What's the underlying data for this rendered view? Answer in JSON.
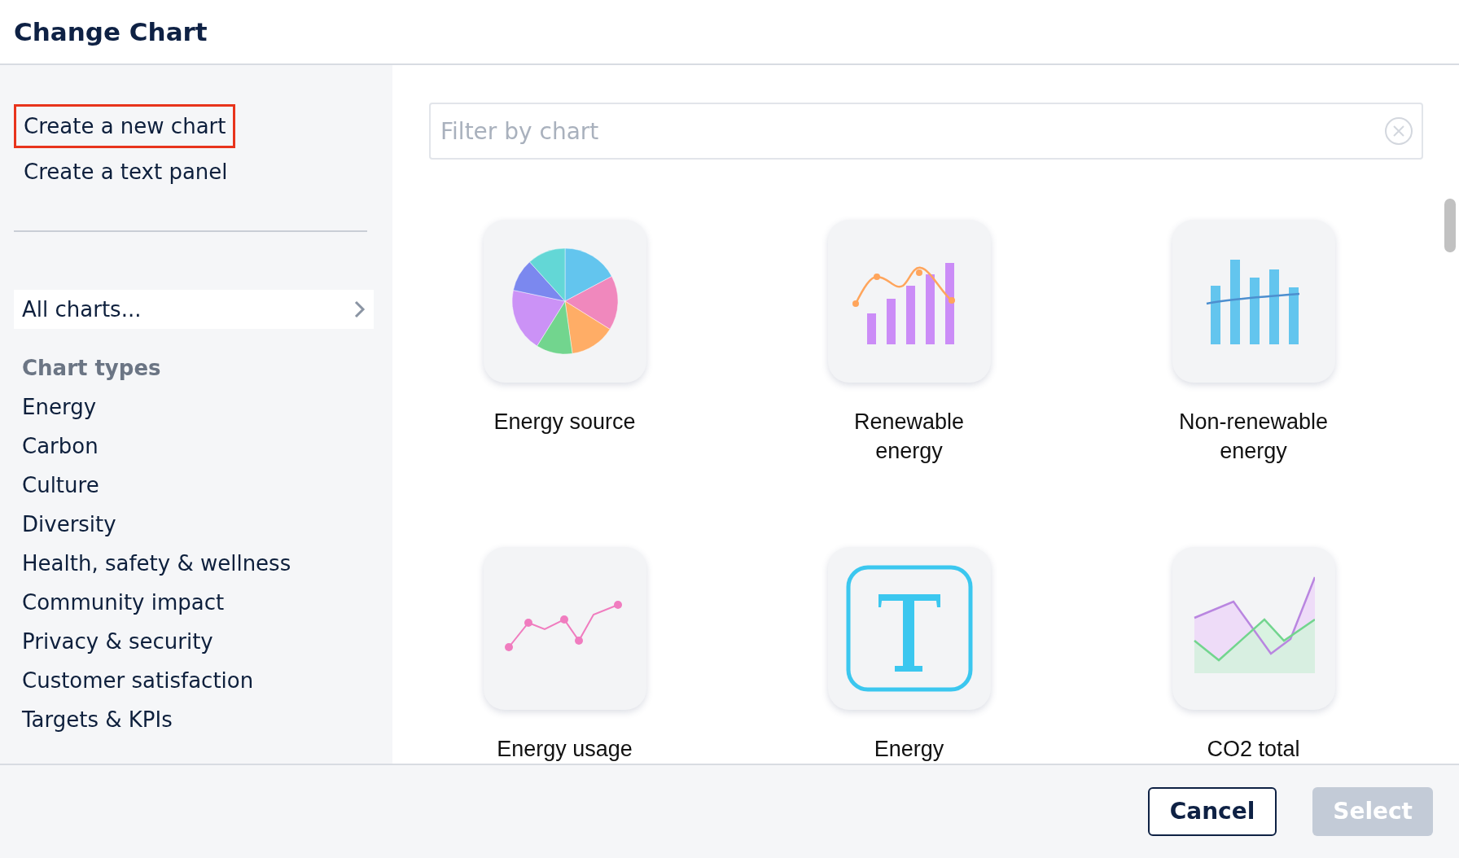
{
  "window": {
    "title": "Change Chart"
  },
  "sidebar": {
    "actions": [
      {
        "label": "Create a new chart",
        "selected": true
      },
      {
        "label": "Create a text panel",
        "selected": false
      }
    ],
    "all_charts": "All charts...",
    "section_title": "Chart types",
    "items": [
      "Energy",
      "Carbon",
      "Culture",
      "Diversity",
      "Health, safety & wellness",
      "Community impact",
      "Privacy & security",
      "Customer satisfaction",
      "Targets & KPIs"
    ]
  },
  "search": {
    "placeholder": "Filter by chart"
  },
  "charts": [
    {
      "kind": "pie",
      "label": "Energy source"
    },
    {
      "kind": "combo",
      "label": "Renewable energy"
    },
    {
      "kind": "bar",
      "label": "Non-renewable energy"
    },
    {
      "kind": "line",
      "label": "Energy usage"
    },
    {
      "kind": "text",
      "label": "Energy"
    },
    {
      "kind": "area",
      "label": "CO2 total"
    }
  ],
  "buttons": [
    {
      "label": "Cancel",
      "disabled": false
    },
    {
      "label": "Select",
      "disabled": true
    }
  ]
}
